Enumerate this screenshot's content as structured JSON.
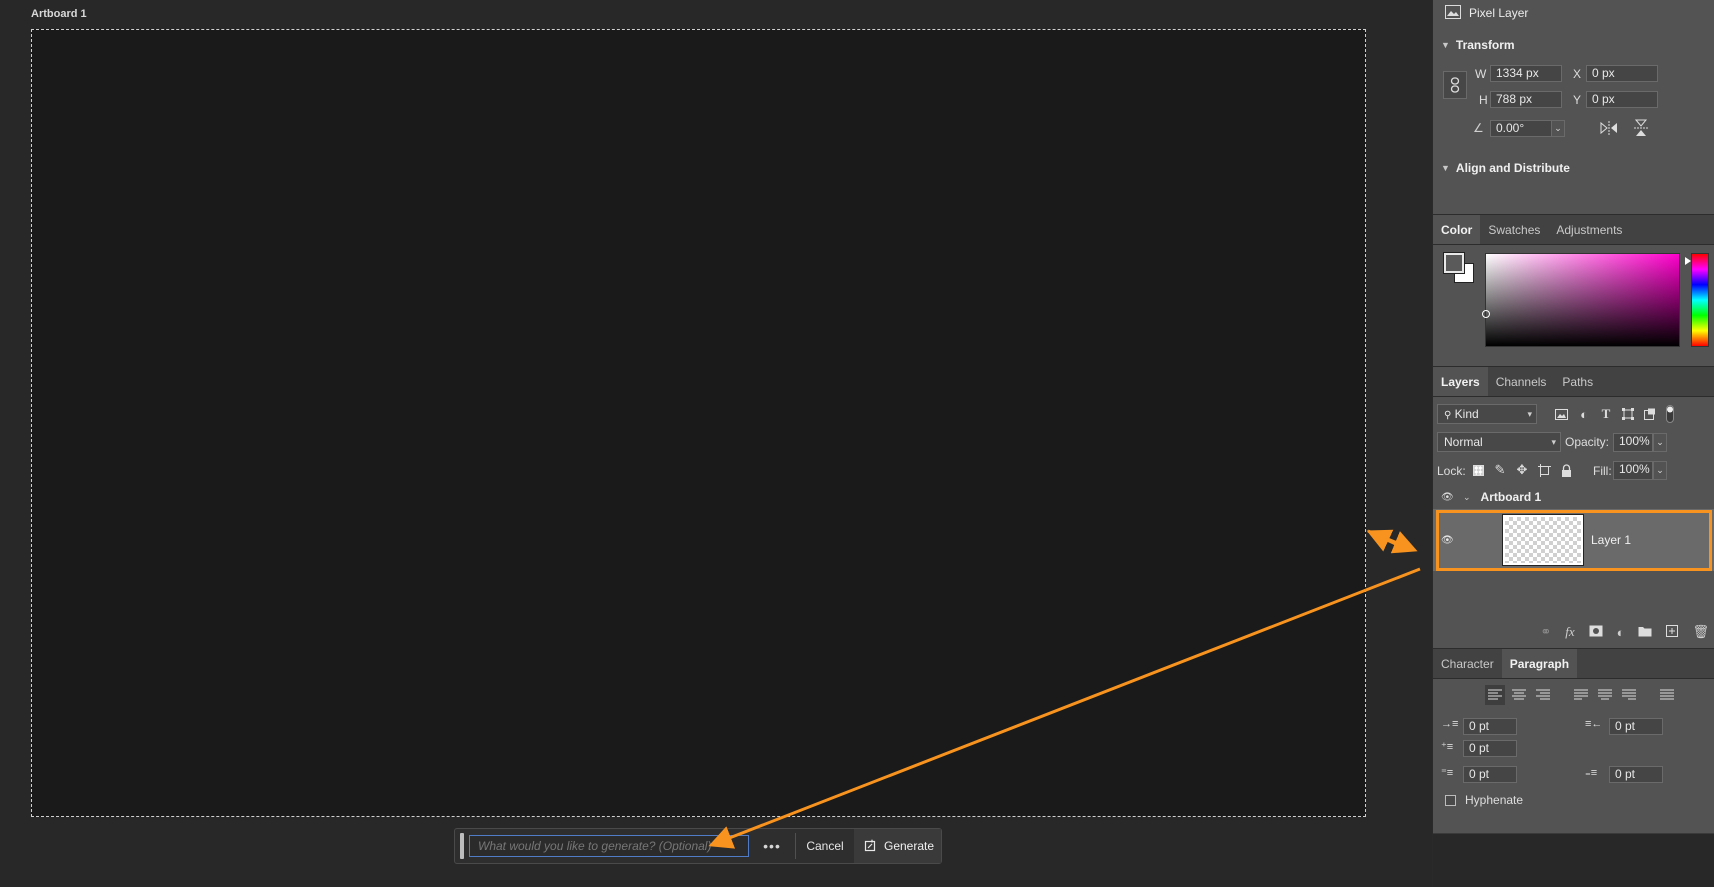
{
  "canvas": {
    "artboard_title": "Artboard 1"
  },
  "taskbar": {
    "prompt_placeholder": "What would you like to generate? (Optional)",
    "more_label": "•••",
    "cancel_label": "Cancel",
    "generate_label": "Generate"
  },
  "properties": {
    "layer_type": "Pixel Layer",
    "transform": {
      "title": "Transform",
      "w_label": "W",
      "w_value": "1334 px",
      "h_label": "H",
      "h_value": "788 px",
      "x_label": "X",
      "x_value": "0 px",
      "y_label": "Y",
      "y_value": "0 px",
      "angle_value": "0.00°"
    },
    "align": {
      "title": "Align and Distribute"
    }
  },
  "color_panel": {
    "tabs": [
      "Color",
      "Swatches",
      "Adjustments"
    ],
    "active_tab": "Color",
    "hue_color": "#ff00cc"
  },
  "layers_panel": {
    "tabs": [
      "Layers",
      "Channels",
      "Paths"
    ],
    "active_tab": "Layers",
    "kind_label": "Kind",
    "blend_mode": "Normal",
    "opacity_label": "Opacity:",
    "opacity_value": "100%",
    "lock_label": "Lock:",
    "fill_label": "Fill:",
    "fill_value": "100%",
    "group_name": "Artboard 1",
    "layer_name": "Layer 1"
  },
  "text_panel": {
    "tabs": [
      "Character",
      "Paragraph"
    ],
    "active_tab": "Paragraph",
    "indent_left": "0 pt",
    "indent_right": "0 pt",
    "indent_first": "0 pt",
    "space_before": "0 pt",
    "space_after": "0 pt",
    "hyphenate_label": "Hyphenate"
  },
  "annotation_color": "#f7931e"
}
